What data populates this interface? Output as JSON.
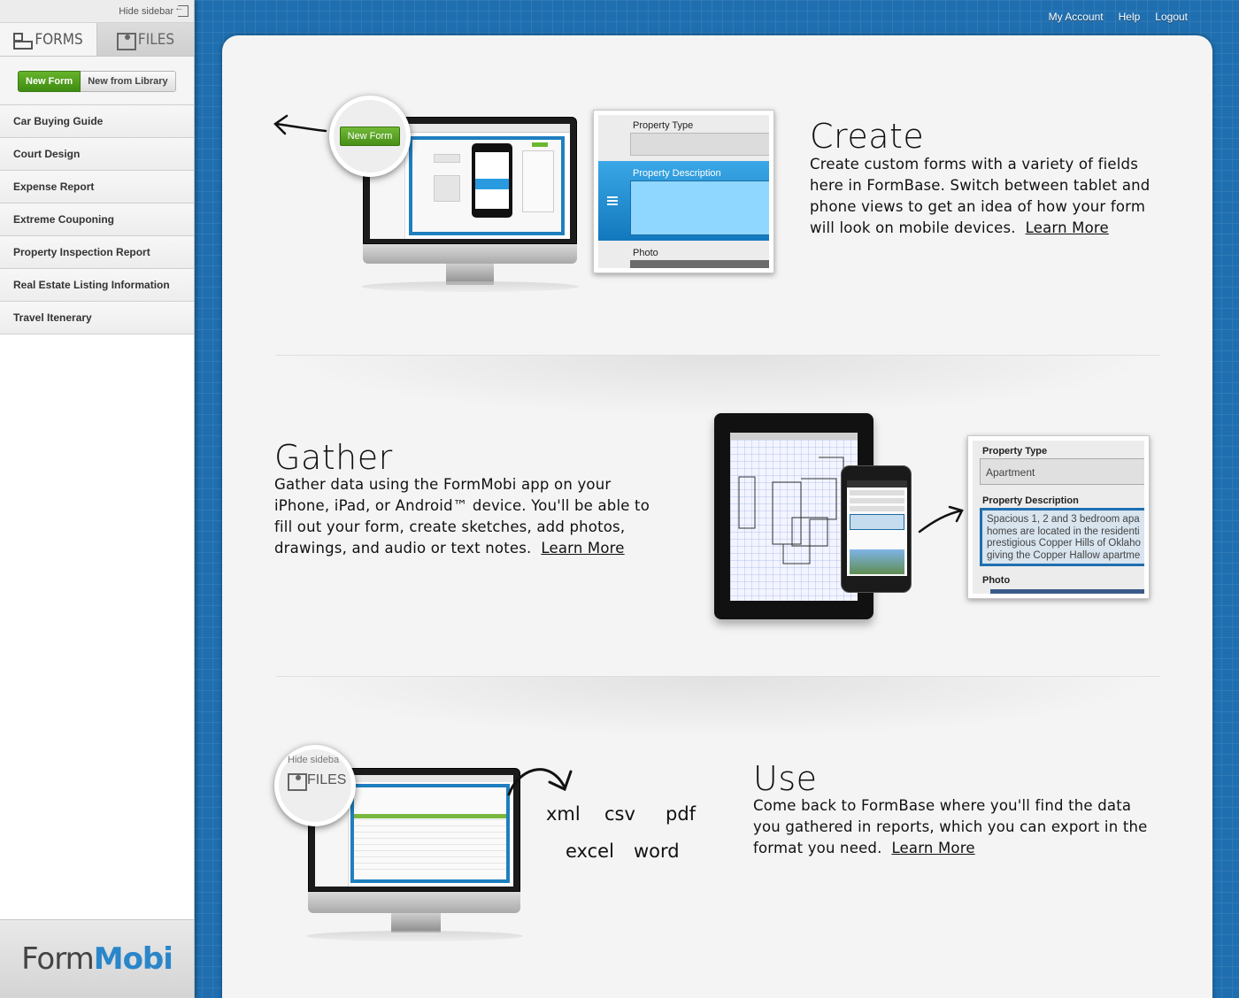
{
  "sidebar": {
    "hide_label": "Hide sidebar",
    "tabs": [
      {
        "label": "FORMS"
      },
      {
        "label": "FILES"
      }
    ],
    "new_form_label": "New Form",
    "new_from_library_label": "New from Library",
    "forms": [
      {
        "label": "Car Buying Guide"
      },
      {
        "label": "Court Design"
      },
      {
        "label": "Expense Report"
      },
      {
        "label": "Extreme Couponing"
      },
      {
        "label": "Property Inspection Report"
      },
      {
        "label": "Real Estate Listing Information"
      },
      {
        "label": "Travel Itenerary"
      }
    ],
    "logo_form": "Form",
    "logo_mobi": "Mobi"
  },
  "topnav": {
    "my_account": "My Account",
    "help": "Help",
    "logout": "Logout"
  },
  "create": {
    "title": "Create",
    "text": "Create custom forms with a variety of fields here in FormBase. Switch between tablet and phone views to get an idea of how your form will look on mobile devices.",
    "learn_more": "Learn More",
    "mag_button": "New Form",
    "card": {
      "property_type": "Property Type",
      "property_description": "Property Description",
      "photo": "Photo"
    }
  },
  "gather": {
    "title": "Gather",
    "text": "Gather data using the FormMobi app on your iPhone, iPad, or Android™ device. You'll be able to fill out your form, create sketches, add photos, drawings, and audio or text notes.",
    "learn_more": "Learn More",
    "card": {
      "property_type": "Property Type",
      "property_type_value": "Apartment",
      "property_description": "Property Description",
      "description_value": "Spacious 1, 2 and 3 bedroom apa homes are located in the residenti prestigious Copper Hills of Oklaho giving the Copper Hallow apartme",
      "photo": "Photo"
    }
  },
  "use": {
    "title": "Use",
    "text": "Come back to FormBase where you'll find the data you gathered in reports, which you can export in the format you need.",
    "learn_more": "Learn More",
    "mag_hide": "Hide sideba",
    "mag_files": "FILES",
    "formats": [
      "xml",
      "csv",
      "pdf",
      "excel",
      "word"
    ]
  },
  "colors": {
    "background": "#1f6fb0",
    "accent_green": "#4f9e1c",
    "accent_blue": "#1d8fd2"
  }
}
